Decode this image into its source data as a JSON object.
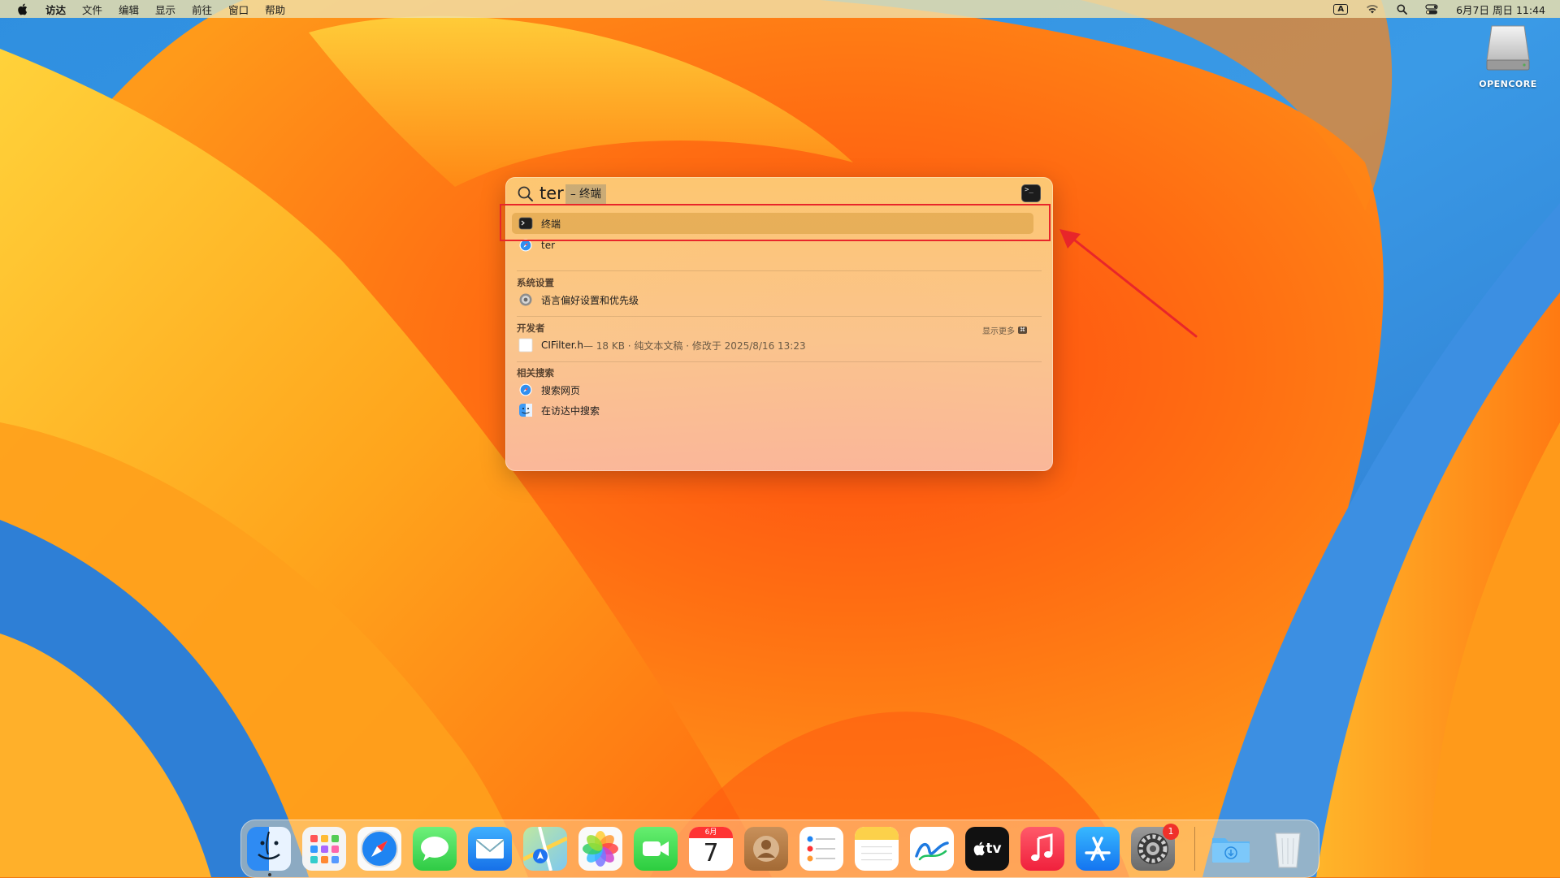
{
  "menubar": {
    "app_name": "访达",
    "items": [
      "文件",
      "编辑",
      "显示",
      "前往",
      "窗口",
      "帮助"
    ],
    "input_source": "A",
    "clock": "6月7日 周日 11:44"
  },
  "desktop": {
    "drive_label": "OPENCORE"
  },
  "spotlight": {
    "query": "ter",
    "completion": "– 终端",
    "top_hit": {
      "label": "终端",
      "icon": "terminal-icon"
    },
    "web_result": {
      "label": "ter",
      "icon": "safari-icon"
    },
    "sections": {
      "system_settings": {
        "header": "系统设置",
        "item": {
          "label": "语言偏好设置和优先级",
          "icon": "settings-icon"
        }
      },
      "developer": {
        "header": "开发者",
        "show_more": "显示更多",
        "show_more_key": "⌘",
        "item": {
          "name": "CIFilter.h",
          "meta": " — 18 KB · 纯文本文稿 · 修改于 2025/8/16 13:23",
          "icon": "document-icon"
        }
      },
      "related": {
        "header": "相关搜索",
        "items": [
          {
            "label": "搜索网页",
            "icon": "safari-icon"
          },
          {
            "label": "在访达中搜索",
            "icon": "finder-icon"
          }
        ]
      }
    }
  },
  "dock": {
    "apps": [
      "Finder",
      "Launchpad",
      "Safari",
      "Messages",
      "Mail",
      "Maps",
      "Photos",
      "FaceTime",
      "Calendar",
      "Contacts",
      "Reminders",
      "Notes",
      "Freeform",
      "Apple TV",
      "Music",
      "App Store",
      "System Settings",
      "Downloads",
      "Trash"
    ],
    "calendar_month": "6月",
    "calendar_day": "7",
    "settings_badge": "1",
    "tv_label": "tv"
  },
  "colors": {
    "highlight": "#e8262a",
    "selected_row": "#dea54b"
  }
}
